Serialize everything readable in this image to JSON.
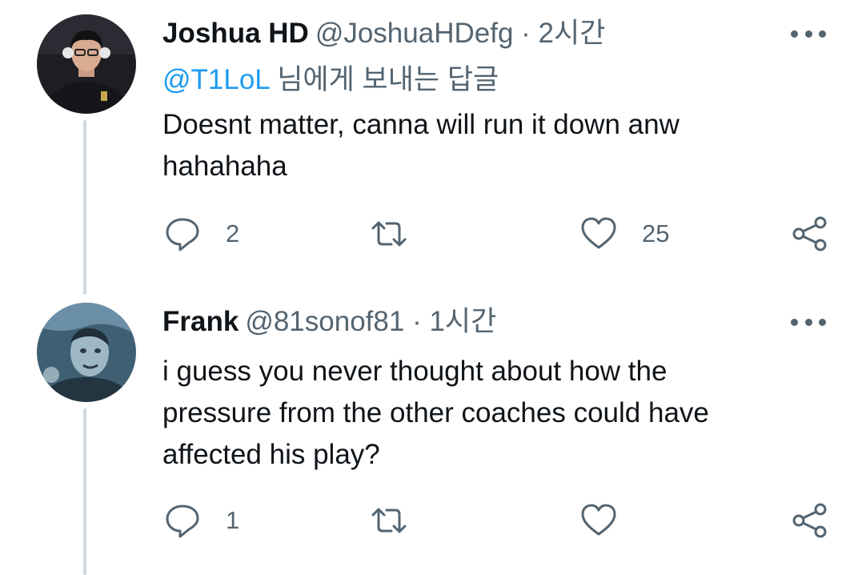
{
  "tweets": [
    {
      "display_name": "Joshua HD",
      "handle": "@JoshuaHDefg",
      "separator": "·",
      "time": "2시간",
      "reply_to": {
        "mention": "@T1LoL",
        "suffix": " 님에게 보내는 답글"
      },
      "text_lines": [
        "Doesnt matter, canna will run it down anw",
        "hahahaha"
      ],
      "reply_count": "2",
      "retweet_count": "",
      "like_count": "25"
    },
    {
      "display_name": "Frank",
      "handle": "@81sonof81",
      "separator": "·",
      "time": "1시간",
      "text_lines": [
        "i guess you never thought about how the",
        "pressure from the other coaches could have",
        "affected his play?"
      ],
      "reply_count": "1",
      "retweet_count": "",
      "like_count": ""
    }
  ],
  "colors": {
    "text": "#0f1419",
    "secondary": "#536471",
    "mention": "#1d9bf0",
    "thread_line": "#cfd9de"
  },
  "icons": [
    "reply-icon",
    "retweet-icon",
    "like-icon",
    "share-icon",
    "more-icon"
  ]
}
